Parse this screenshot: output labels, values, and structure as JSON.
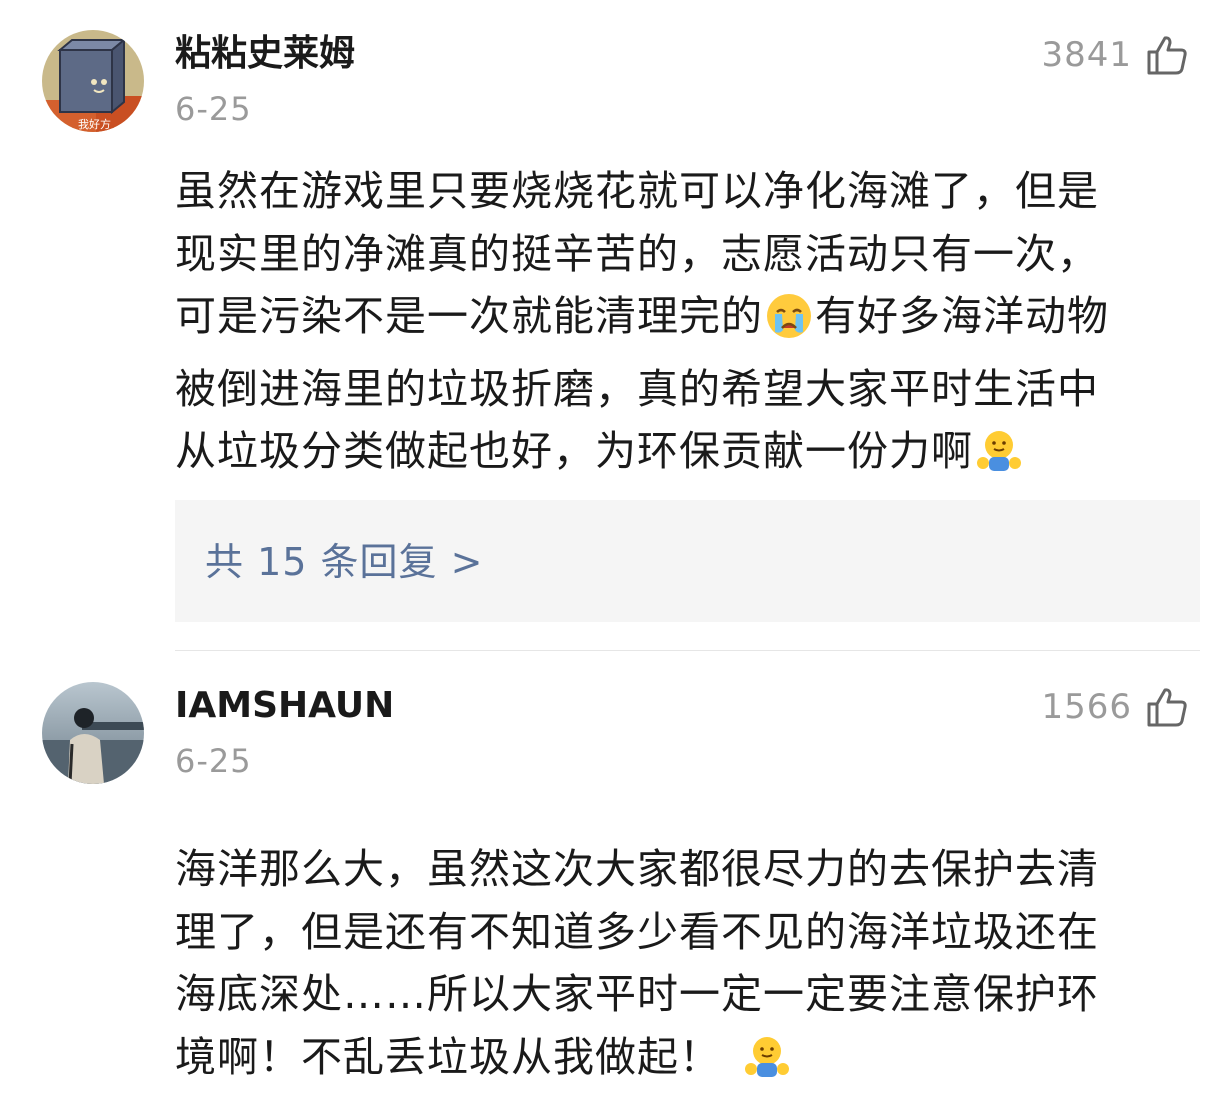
{
  "comments": [
    {
      "username": "粘粘史莱姆",
      "date": "6-25",
      "likes": "3841",
      "avatar_caption": "我好方",
      "lines": [
        "虽然在游戏里只要烧烧花就可以净化海滩了，但是",
        "现实里的净滩真的挺辛苦的，志愿活动只有一次，",
        "可是污染不是一次就能清理完的",
        "有好多海洋动物",
        "被倒进海里的垃圾折磨，真的希望大家平时生活中",
        "从垃圾分类做起也好，为环保贡献一份力啊"
      ],
      "emojis": [
        "crying-emoji",
        "hug-emoji"
      ],
      "replies_label": "共 15 条回复 >"
    },
    {
      "username": "IAMSHAUN",
      "date": "6-25",
      "likes": "1566",
      "lines": [
        "海洋那么大，虽然这次大家都很尽力的去保护去清",
        "理了，但是还有不知道多少看不见的海洋垃圾还在",
        "海底深处……所以大家平时一定一定要注意保护环",
        "境啊！不乱丢垃圾从我做起！"
      ],
      "emojis": [
        "hug-emoji"
      ]
    }
  ],
  "colors": {
    "text": "#1a1a1a",
    "muted": "#9a9a9a",
    "reply_link": "#5a7299",
    "reply_bg": "#f5f5f5",
    "divider": "#e6e6e6"
  }
}
